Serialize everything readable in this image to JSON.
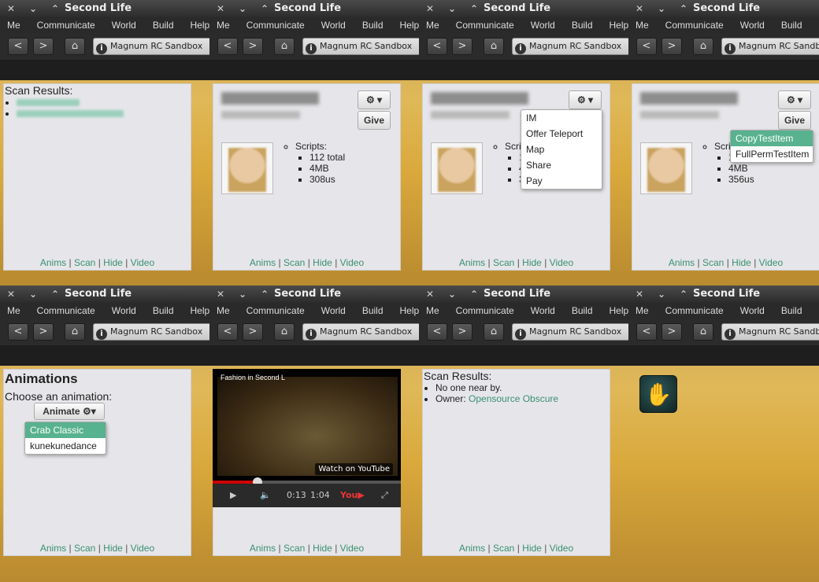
{
  "window": {
    "title": "Second Life",
    "menu": [
      "Me",
      "Communicate",
      "World",
      "Build",
      "Help"
    ],
    "location": "Magnum RC Sandbox"
  },
  "hud_footer": {
    "anims": "Anims",
    "scan": "Scan",
    "hide": "Hide",
    "video": "Video",
    "sep": "|"
  },
  "panel1": {
    "scan_title": "Scan Results:"
  },
  "profile": {
    "give_label": "Give",
    "scripts_label": "Scripts:",
    "total": "112 total",
    "memory": "4MB",
    "time_a": "308us",
    "time_c": "356us"
  },
  "avatar_menu": [
    "IM",
    "Offer Teleport",
    "Map",
    "Share",
    "Pay"
  ],
  "item_menu": {
    "active": "CopyTestItem",
    "other": "FullPermTestItem"
  },
  "animations": {
    "title": "Animations",
    "subtitle": "Choose an animation:",
    "button": "Animate",
    "options": [
      "Crab Classic",
      "kunekunedance"
    ],
    "selected": "Crab Classic"
  },
  "video": {
    "title": "Fashion in Second L",
    "badge": "Watch on YouTube",
    "time": "0:13",
    "duration": "1:04",
    "progress": 0.24
  },
  "scan2": {
    "title": "Scan Results:",
    "line1": "No one near by.",
    "owner_label": "Owner: ",
    "owner_name": "Opensource Obscure"
  },
  "colors": {
    "link": "#3a8f6f",
    "highlight": "#58b28f",
    "hud_bg": "#e6e6ea"
  }
}
